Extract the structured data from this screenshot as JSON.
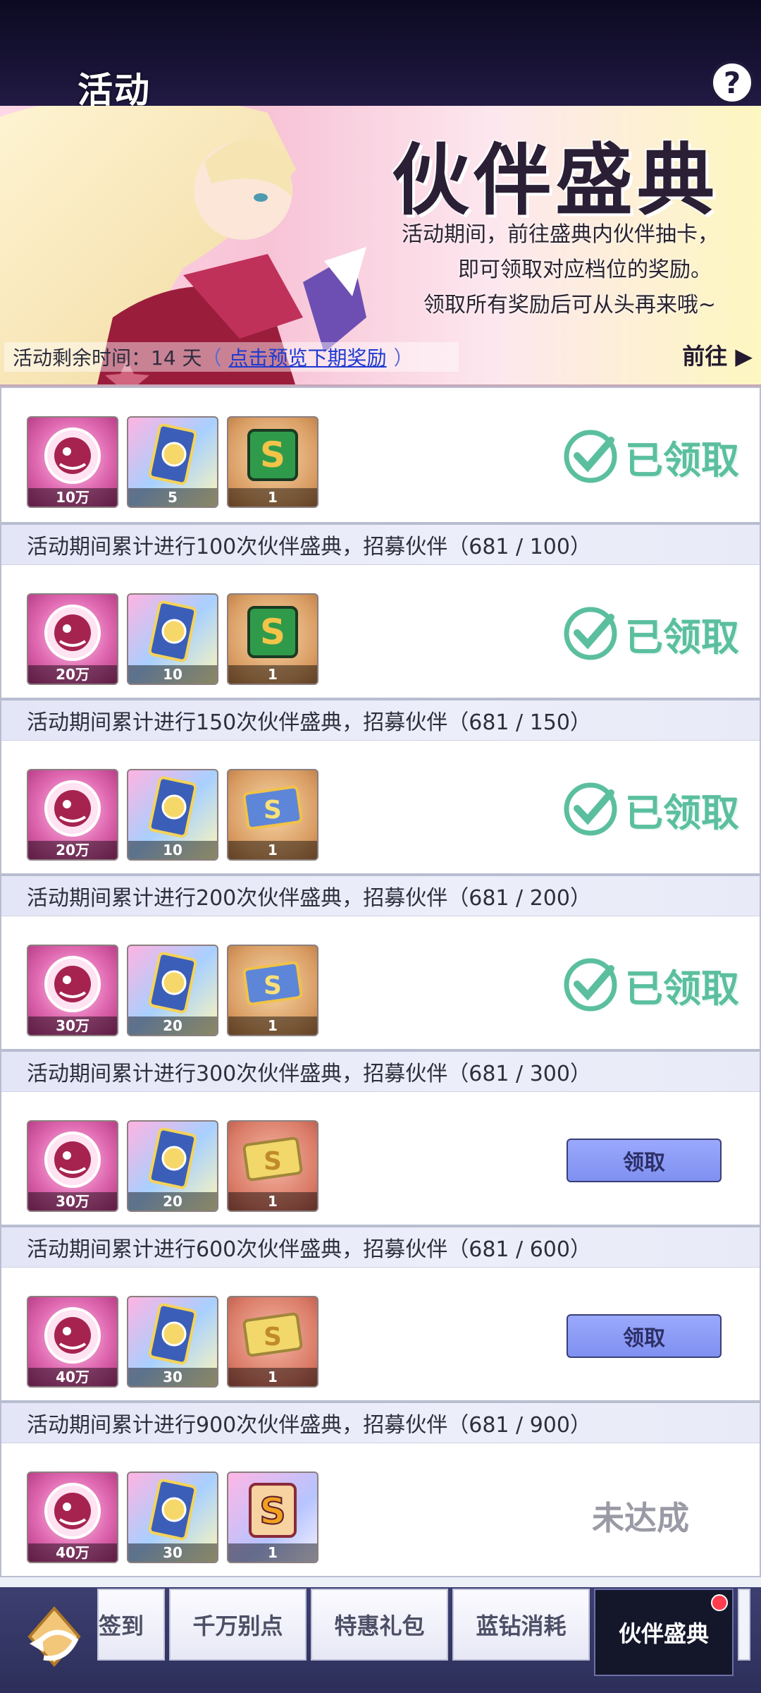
{
  "header": {
    "title": "活动",
    "help_icon": "question-icon",
    "help_label": "?"
  },
  "banner": {
    "title": "伙伴盛典",
    "desc_lines": [
      "活动期间，前往盛典内伙伴抽卡，",
      "即可领取对应档位的奖励。",
      "领取所有奖励后可从头再来哦~"
    ],
    "timer_label": "活动剩余时间：14 天",
    "paren_open": "（",
    "preview_link": "点击预览下期奖励",
    "paren_close": "）",
    "goto_label": "前往"
  },
  "tiers": [
    {
      "header": "",
      "status": "已领取",
      "items": [
        {
          "type": "gem",
          "qty": "10万"
        },
        {
          "type": "card",
          "qty": "5"
        },
        {
          "type": "ticket-green",
          "qty": "1"
        }
      ]
    },
    {
      "header": "活动期间累计进行100次伙伴盛典，招募伙伴（681 / 100）",
      "status": "已领取",
      "items": [
        {
          "type": "gem",
          "qty": "20万"
        },
        {
          "type": "card",
          "qty": "10"
        },
        {
          "type": "ticket-green",
          "qty": "1"
        }
      ]
    },
    {
      "header": "活动期间累计进行150次伙伴盛典，招募伙伴（681 / 150）",
      "status": "已领取",
      "items": [
        {
          "type": "gem",
          "qty": "20万"
        },
        {
          "type": "card",
          "qty": "10"
        },
        {
          "type": "ticket-blue",
          "qty": "1"
        }
      ]
    },
    {
      "header": "活动期间累计进行200次伙伴盛典，招募伙伴（681 / 200）",
      "status": "已领取",
      "items": [
        {
          "type": "gem",
          "qty": "30万"
        },
        {
          "type": "card",
          "qty": "20"
        },
        {
          "type": "ticket-blue",
          "qty": "1"
        }
      ]
    },
    {
      "header": "活动期间累计进行300次伙伴盛典，招募伙伴（681 / 300）",
      "status": "领取",
      "items": [
        {
          "type": "gem",
          "qty": "30万"
        },
        {
          "type": "card",
          "qty": "20"
        },
        {
          "type": "ticket-gold",
          "qty": "1"
        }
      ]
    },
    {
      "header": "活动期间累计进行600次伙伴盛典，招募伙伴（681 / 600）",
      "status": "领取",
      "items": [
        {
          "type": "gem",
          "qty": "40万"
        },
        {
          "type": "card",
          "qty": "30"
        },
        {
          "type": "ticket-gold",
          "qty": "1"
        }
      ]
    },
    {
      "header": "活动期间累计进行900次伙伴盛典，招募伙伴（681 / 900）",
      "status": "未达成",
      "items": [
        {
          "type": "gem",
          "qty": "40万"
        },
        {
          "type": "card",
          "qty": "30"
        },
        {
          "type": "ticket-purple",
          "qty": "1"
        }
      ]
    }
  ],
  "bottom_nav": {
    "back_icon": "back-arrow-icon",
    "tabs": [
      "签到",
      "千万别点",
      "特惠礼包",
      "蓝钻消耗",
      "伙伴盛典"
    ]
  },
  "colors": {
    "claimed": "#5bbf9f",
    "claim_button": "#8a9af5",
    "not_done": "#9a9aa6"
  }
}
